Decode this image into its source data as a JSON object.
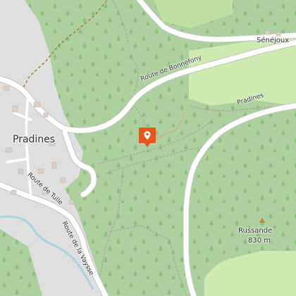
{
  "map": {
    "places": {
      "town": "Pradines",
      "hamlet": "Sénéjoux",
      "locality": "Pradines"
    },
    "roads": {
      "bonnefony": "Route de Bonnefony",
      "tulle": "Route de Tulle",
      "vaysse": "Route de la Vaysse"
    },
    "peak": {
      "name": "Russande",
      "elevation": "830 m"
    },
    "marker": {
      "icon": "location-pin-icon",
      "color": "#e8561c"
    },
    "colors": {
      "forest": "#add19e",
      "meadow": "#cdebb0",
      "residential": "#e0dfdf",
      "road": "#ffffff",
      "river": "#aad3df",
      "track": "#ac8327"
    }
  }
}
